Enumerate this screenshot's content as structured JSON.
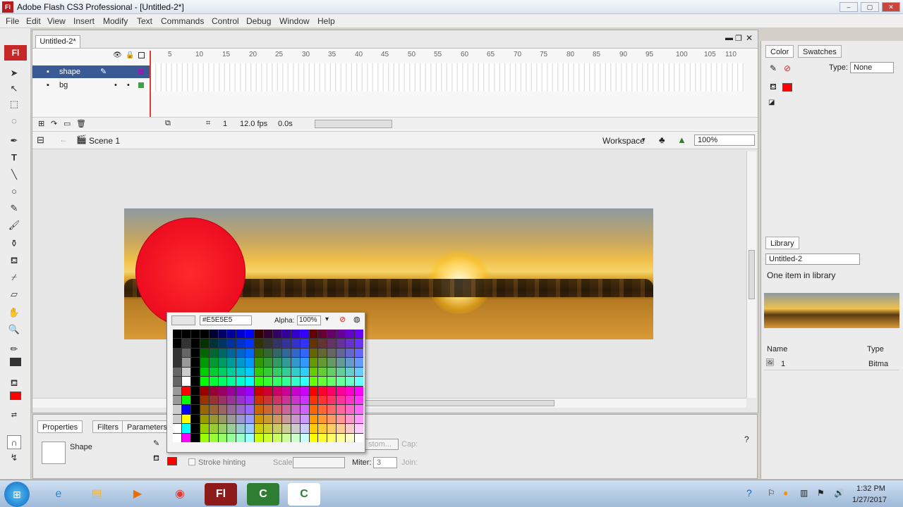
{
  "app": {
    "title": "Adobe Flash CS3 Professional - [Untitled-2*]",
    "badge": "Fl"
  },
  "menu": [
    "File",
    "Edit",
    "View",
    "Insert",
    "Modify",
    "Text",
    "Commands",
    "Control",
    "Debug",
    "Window",
    "Help"
  ],
  "document": {
    "tab": "Untitled-2*",
    "layers": [
      {
        "name": "shape"
      },
      {
        "name": "bg"
      }
    ],
    "ruler": [
      "5",
      "10",
      "15",
      "20",
      "25",
      "30",
      "35",
      "40",
      "45",
      "50",
      "55",
      "60",
      "65",
      "70",
      "75",
      "80",
      "85",
      "90",
      "95",
      "100",
      "105",
      "110"
    ],
    "status": {
      "frame": "1",
      "fps": "12.0 fps",
      "time": "0.0s"
    },
    "scene": "Scene 1",
    "workspace": "Workspace",
    "zoom": "100%"
  },
  "picker": {
    "hex": "#E5E5E5",
    "alpha_label": "Alpha:",
    "alpha": "100%"
  },
  "properties": {
    "tabs": [
      "Properties",
      "Filters",
      "Parameters"
    ],
    "object": "Shape",
    "stroke_hinting": "Stroke hinting",
    "scale_label": "Scale:",
    "miter_label": "Miter:",
    "miter": "3",
    "join_label": "Join:",
    "cap_label": "Cap:",
    "custom_label": "stom..."
  },
  "color_panel": {
    "tabs": [
      "Color",
      "Swatches"
    ],
    "type_label": "Type:",
    "type": "None"
  },
  "library": {
    "tab": "Library",
    "doc": "Untitled-2",
    "count": "One item in library",
    "col_name": "Name",
    "col_type": "Type",
    "item_name": "1",
    "item_type": "Bitma"
  },
  "taskbar": {
    "time": "1:32 PM",
    "date": "1/27/2017"
  },
  "colors": {
    "fill": "#ff0000",
    "accent": "#c62828"
  }
}
